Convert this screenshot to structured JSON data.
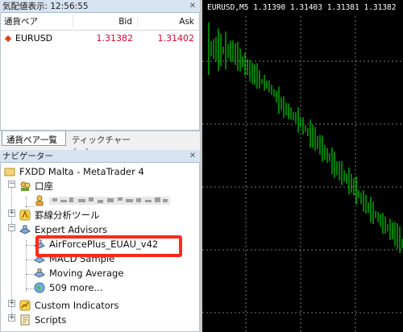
{
  "market_watch": {
    "title": "気配値表示: 12:56:55",
    "col_symbol": "通貨ペア",
    "col_bid": "Bid",
    "col_ask": "Ask",
    "rows": [
      {
        "symbol": "EURUSD",
        "bid": "1.31382",
        "ask": "1.31402"
      }
    ]
  },
  "tabs": {
    "pairs": "通貨ペア一覧",
    "tick": "ティックチャート"
  },
  "navigator": {
    "title": "ナビゲーター",
    "root": "FXDD Malta - MetaTrader 4",
    "accounts": "口座",
    "indicators": "罫線分析ツール",
    "expert_advisors": "Expert Advisors",
    "ea_items": [
      "AirForcePlus_EUAU_v42",
      "MACD Sample",
      "Moving Average",
      "509 more..."
    ],
    "custom_indicators": "Custom Indicators",
    "scripts": "Scripts"
  },
  "chart": {
    "info": "EURUSD,M5  1.31390 1.31403 1.31381 1.31382",
    "grid": true,
    "up_color": "#00ff00",
    "background": "#000000"
  },
  "colors": {
    "price_red": "#e0002a",
    "highlight": "#ff2a1a"
  }
}
